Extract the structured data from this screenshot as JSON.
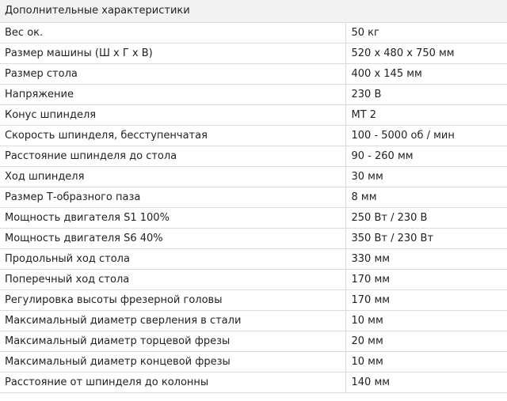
{
  "table": {
    "header": "Дополнительные характеристики",
    "rows": [
      {
        "label": "Вес ок.",
        "value": "50 кг"
      },
      {
        "label": "Размер машины (Ш х Г х В)",
        "value": "520 х 480 х 750 мм"
      },
      {
        "label": "Размер стола",
        "value": "400 х 145 мм"
      },
      {
        "label": "Напряжение",
        "value": "230 В"
      },
      {
        "label": "Конус шпинделя",
        "value": "МТ 2"
      },
      {
        "label": "Скорость шпинделя, бесступенчатая",
        "value": "100 - 5000 об / мин"
      },
      {
        "label": "Расстояние шпинделя до стола",
        "value": "90 - 260 мм"
      },
      {
        "label": "Ход шпинделя",
        "value": "30 мм"
      },
      {
        "label": "Размер Т-образного паза",
        "value": "8 мм"
      },
      {
        "label": "Мощность двигателя S1 100%",
        "value": "250 Вт / 230 В"
      },
      {
        "label": "Мощность двигателя S6 40%",
        "value": "350 Вт / 230 Вт"
      },
      {
        "label": "Продольный ход стола",
        "value": "330 мм"
      },
      {
        "label": "Поперечный ход стола",
        "value": "170 мм"
      },
      {
        "label": "Регулировка высоты фрезерной головы",
        "value": "170 мм"
      },
      {
        "label": "Максимальный диаметр сверления в стали",
        "value": "10 мм"
      },
      {
        "label": "Максимальный диаметр торцевой фрезы",
        "value": "20 мм"
      },
      {
        "label": "Максимальный диаметр концевой фрезы",
        "value": "10 мм"
      },
      {
        "label": "Расстояние от шпинделя до колонны",
        "value": "140 мм"
      }
    ]
  }
}
